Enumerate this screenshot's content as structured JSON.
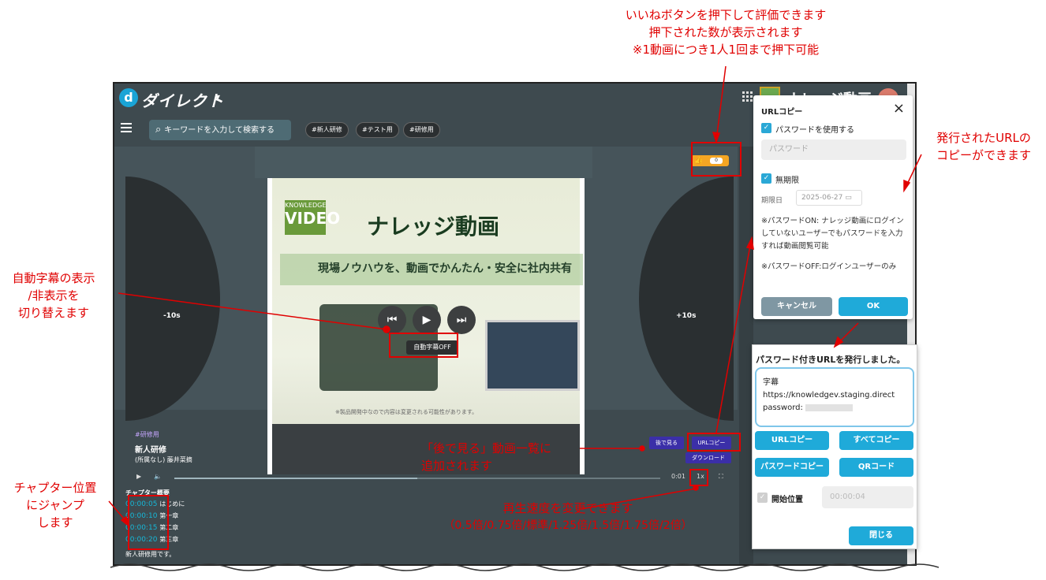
{
  "app": {
    "logo_letter": "d",
    "logo_text": "ダイレクト",
    "caret": "▾",
    "title": "ナレッジ動画"
  },
  "toolbar": {
    "search_placeholder": "キーワードを入力して検索する",
    "tags": [
      "#新人研修",
      "#テスト用",
      "#研修用"
    ]
  },
  "player": {
    "rewind_label": "-10s",
    "forward_label": "+10s",
    "like_icon": "thumbs-up-icon",
    "like_count": "0",
    "subtitle_toggle": "自動字幕OFF",
    "video": {
      "logo_small": "KNOWLEDGE",
      "logo_big": "VIDEO",
      "title": "ナレッジ動画",
      "subtitle": "現場ノウハウを、動画でかんたん・安全に社内共有",
      "note": "※製品開発中なので内容は変更される可能性があります。"
    },
    "meta": {
      "tag": "#研修用",
      "title": "新人研修",
      "owner": "(所属なし) 藤井菜摘"
    },
    "watch_later_label": "後で見る",
    "url_copy_label": "URLコピー",
    "download_label": "ダウンロード",
    "time": "0:01",
    "speed": "1x",
    "progress": 0.5
  },
  "chapters": {
    "heading": "チャプター概要",
    "items": [
      {
        "time": "00:00:05",
        "name": "はじめに"
      },
      {
        "time": "00:00:10",
        "name": "第一章"
      },
      {
        "time": "00:00:15",
        "name": "第二章"
      },
      {
        "time": "00:00:20",
        "name": "第三章"
      }
    ],
    "description": "新人研修用です。"
  },
  "url_popup": {
    "title": "URLコピー",
    "use_password_label": "パスワードを使用する",
    "password_placeholder": "パスワード",
    "unlimited_label": "無期限",
    "expiry_label": "期限日",
    "expiry_value": "2025-06-27",
    "note_on": "※パスワードON: ナレッジ動画にログインしていないユーザーでもパスワードを入力すれば動画閲覧可能",
    "note_off": "※パスワードOFF:ログインユーザーのみ",
    "cancel_label": "キャンセル",
    "ok_label": "OK"
  },
  "issued_popup": {
    "title": "パスワード付きURLを発行しました。",
    "content_title": "字幕",
    "url": "https://knowledgev.staging.direct",
    "password_label": "password:",
    "url_copy_label": "URLコピー",
    "copy_all_label": "すべてコピー",
    "password_copy_label": "パスワードコピー",
    "qr_label": "QRコード",
    "start_position_label": "開始位置",
    "start_position_value": "00:00:04",
    "close_label": "閉じる"
  },
  "annotations": {
    "like": [
      "いいねボタンを押下して評価できます",
      "押下された数が表示されます",
      "※1動画につき1人1回まで押下可能"
    ],
    "url": [
      "発行されたURLの",
      "コピーができます"
    ],
    "subtitle": [
      "自動字幕の表示",
      "/非表示を",
      "切り替えます"
    ],
    "chapter": [
      "チャプター位置",
      "にジャンプ",
      "します"
    ],
    "later": [
      "「後で見る」動画一覧に",
      "追加されます"
    ],
    "speed": [
      "再生速度を変更できます",
      "（0.5倍/0.75倍/標準/1.25倍/1.5倍/1.75倍/2倍）"
    ]
  },
  "colors": {
    "accent": "#1faad9",
    "annotation": "#e00000",
    "purple_button": "#3b2fa8",
    "like": "#f5a623"
  }
}
